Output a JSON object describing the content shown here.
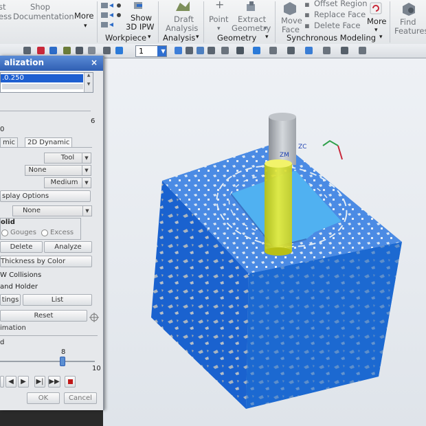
{
  "ribbon": {
    "partial_left": "st",
    "partial_left2": "ess",
    "shop_doc": [
      "Shop",
      "Documentation"
    ],
    "more1": "More",
    "show_3d_ipw": [
      "Show",
      "3D IPW"
    ],
    "workpiece": "Workpiece",
    "draft_analysis": [
      "Draft",
      "Analysis"
    ],
    "analysis": "Analysis",
    "point": "Point",
    "extract_geometry": [
      "Extract",
      "Geometry"
    ],
    "geometry": "Geometry",
    "move_face": [
      "Move",
      "Face"
    ],
    "offset_region": "Offset Region",
    "replace_face": "Replace Face",
    "delete_face": "Delete Face",
    "more2": "More",
    "synchronous_modeling": "Synchronous Modeling",
    "find_features": [
      "Find",
      "Features"
    ]
  },
  "toolbar": {
    "combo_value": "1"
  },
  "dialog": {
    "title": "alization",
    "close": "×",
    "selected_value": ".0.250",
    "count_left": "0",
    "count_right": "6",
    "tab_3d": "mic",
    "tab_2d": "2D Dynamic",
    "tool_drop": "Tool",
    "none_drop": "None",
    "medium_drop": "Medium",
    "display_options": "splay Options",
    "none_drop2": "None",
    "group_label": "olid",
    "gouges": "Gouges",
    "excess": "Excess",
    "delete": "Delete",
    "analyze": "Analyze",
    "thickness_by_color": "Thickness by Color",
    "collisions": "W Collisions",
    "and_holder": "and Holder",
    "settings": "tings",
    "list": "List",
    "reset": "Reset",
    "animation": "imation",
    "speed_label": "d",
    "speed_value": "8",
    "speed_max": "10",
    "speed_level": 0.8,
    "ok": "OK",
    "cancel": "Cancel"
  },
  "viewport": {
    "axis_zm": "ZM",
    "axis_zc": "ZC"
  },
  "colors": {
    "part_blue": "#1a62cf",
    "material_blue": "#3a9ee8",
    "tool_yellow": "#d9e020"
  }
}
